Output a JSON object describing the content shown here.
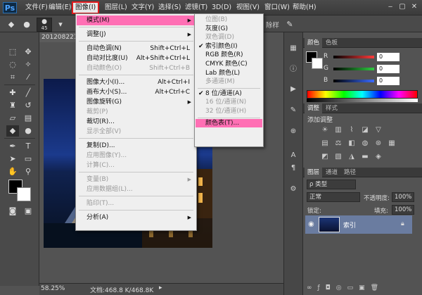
{
  "app": {
    "logo": "Ps",
    "window_controls": [
      "‒",
      "▢",
      "✕"
    ]
  },
  "menubar": {
    "items": [
      "文件(F)",
      "编辑(E)",
      "图像(I)",
      "图层(L)",
      "文字(Y)",
      "选择(S)",
      "滤镜(T)",
      "3D(D)",
      "视图(V)",
      "窗口(W)",
      "帮助(H)"
    ]
  },
  "options_bar": {
    "brush_size": "45",
    "refine_text": "除样"
  },
  "document": {
    "tab_title": "201208221",
    "zoom": "58.25%",
    "doc_size": "文档:468.8 K/468.8K"
  },
  "image_menu": {
    "items": [
      {
        "label": "模式(M)",
        "shortcut": "",
        "submenu": true,
        "disabled": false,
        "highlight": true
      },
      {
        "sep": true
      },
      {
        "label": "调整(J)",
        "shortcut": "",
        "submenu": true,
        "disabled": false
      },
      {
        "sep": true
      },
      {
        "label": "自动色调(N)",
        "shortcut": "Shift+Ctrl+L",
        "disabled": false
      },
      {
        "label": "自动对比度(U)",
        "shortcut": "Alt+Shift+Ctrl+L",
        "disabled": false
      },
      {
        "label": "自动颜色(O)",
        "shortcut": "Shift+Ctrl+B",
        "disabled": true
      },
      {
        "sep": true
      },
      {
        "label": "图像大小(I)...",
        "shortcut": "Alt+Ctrl+I",
        "disabled": false
      },
      {
        "label": "画布大小(S)...",
        "shortcut": "Alt+Ctrl+C",
        "disabled": false
      },
      {
        "label": "图像旋转(G)",
        "shortcut": "",
        "submenu": true,
        "disabled": false
      },
      {
        "label": "裁剪(P)",
        "shortcut": "",
        "disabled": true
      },
      {
        "label": "裁切(R)...",
        "shortcut": "",
        "disabled": false
      },
      {
        "label": "显示全部(V)",
        "shortcut": "",
        "disabled": true
      },
      {
        "sep": true
      },
      {
        "label": "复制(D)...",
        "shortcut": "",
        "disabled": false
      },
      {
        "label": "应用图像(Y)...",
        "shortcut": "",
        "disabled": true
      },
      {
        "label": "计算(C)...",
        "shortcut": "",
        "disabled": true
      },
      {
        "sep": true
      },
      {
        "label": "变量(B)",
        "shortcut": "",
        "submenu": true,
        "disabled": true
      },
      {
        "label": "应用数据组(L)...",
        "shortcut": "",
        "disabled": true
      },
      {
        "sep": true
      },
      {
        "label": "陷印(T)...",
        "shortcut": "",
        "disabled": true
      },
      {
        "sep": true
      },
      {
        "label": "分析(A)",
        "shortcut": "",
        "submenu": true,
        "disabled": false
      }
    ]
  },
  "mode_submenu": {
    "items": [
      {
        "label": "位图(B)",
        "disabled": true
      },
      {
        "label": "灰度(G)",
        "disabled": false
      },
      {
        "label": "双色调(D)",
        "disabled": true
      },
      {
        "label": "索引颜色(I)",
        "disabled": false,
        "checked": true
      },
      {
        "label": "RGB 颜色(R)",
        "disabled": false
      },
      {
        "label": "CMYK 颜色(C)",
        "disabled": false
      },
      {
        "label": "Lab 颜色(L)",
        "disabled": false
      },
      {
        "label": "多通道(M)",
        "disabled": true
      },
      {
        "sep": true
      },
      {
        "label": "8 位/通道(A)",
        "disabled": false,
        "checked": true
      },
      {
        "label": "16 位/通道(N)",
        "disabled": true
      },
      {
        "label": "32 位/通道(H)",
        "disabled": true
      },
      {
        "sep": true
      },
      {
        "label": "颜色表(T)...",
        "disabled": false,
        "highlight": true
      }
    ]
  },
  "color_panel": {
    "tabs": [
      "颜色",
      "色板"
    ],
    "channels": [
      {
        "label": "R",
        "value": "0",
        "color": "#ff3b3b"
      },
      {
        "label": "G",
        "value": "0",
        "color": "#2ecc40"
      },
      {
        "label": "B",
        "value": "0",
        "color": "#3b6bff"
      }
    ]
  },
  "adjustments_panel": {
    "tabs": [
      "调整",
      "样式"
    ],
    "title": "添加调整"
  },
  "layers_panel": {
    "tabs": [
      "图层",
      "通道",
      "路径"
    ],
    "kind_label": "ρ 类型",
    "blend_mode": "正常",
    "opacity_label": "不透明度:",
    "opacity_value": "100%",
    "lock_label": "锁定:",
    "fill_label": "填充:",
    "fill_value": "100%",
    "layer_name": "索引"
  },
  "colors": {
    "accent_menu_highlight": "#ff6fb4",
    "menu_outline": "#e0191c"
  }
}
